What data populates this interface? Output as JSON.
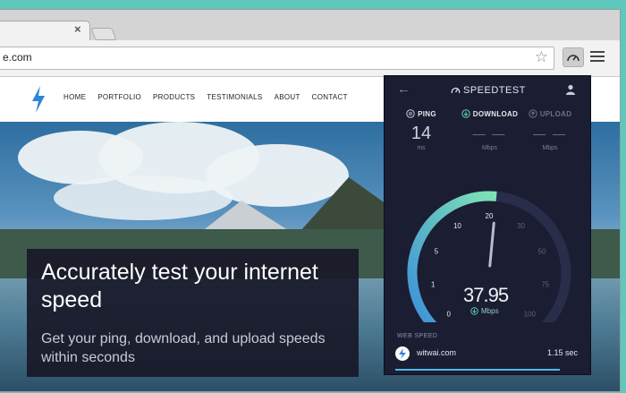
{
  "browser": {
    "url": "e.com",
    "tab_close": "×"
  },
  "site": {
    "nav": [
      "HOME",
      "PORTFOLIO",
      "PRODUCTS",
      "TESTIMONIALS",
      "ABOUT",
      "CONTACT"
    ],
    "headline": "Accurately test your internet speed",
    "subline": "Get your ping, download, and upload speeds within seconds"
  },
  "speedtest": {
    "title": "SPEEDTEST",
    "ping": {
      "label": "PING",
      "value": "14",
      "unit": "ms"
    },
    "download": {
      "label": "DOWNLOAD",
      "value": "— —",
      "unit": "Mbps"
    },
    "upload": {
      "label": "UPLOAD",
      "value": "— —",
      "unit": "Mbps"
    },
    "gauge_ticks": [
      "0",
      "1",
      "5",
      "10",
      "20",
      "30",
      "50",
      "75",
      "100"
    ],
    "gauge_progress_fraction": 0.52,
    "current_speed": "37.95",
    "current_unit": "Mbps",
    "web_speed_label": "WEB SPEED",
    "web_speed_site": "witwai.com",
    "web_speed_time": "1.15 sec",
    "colors": {
      "accent_teal": "#5ed6b0",
      "accent_blue": "#3b8fd8",
      "panel_bg": "#1b1d33"
    }
  }
}
